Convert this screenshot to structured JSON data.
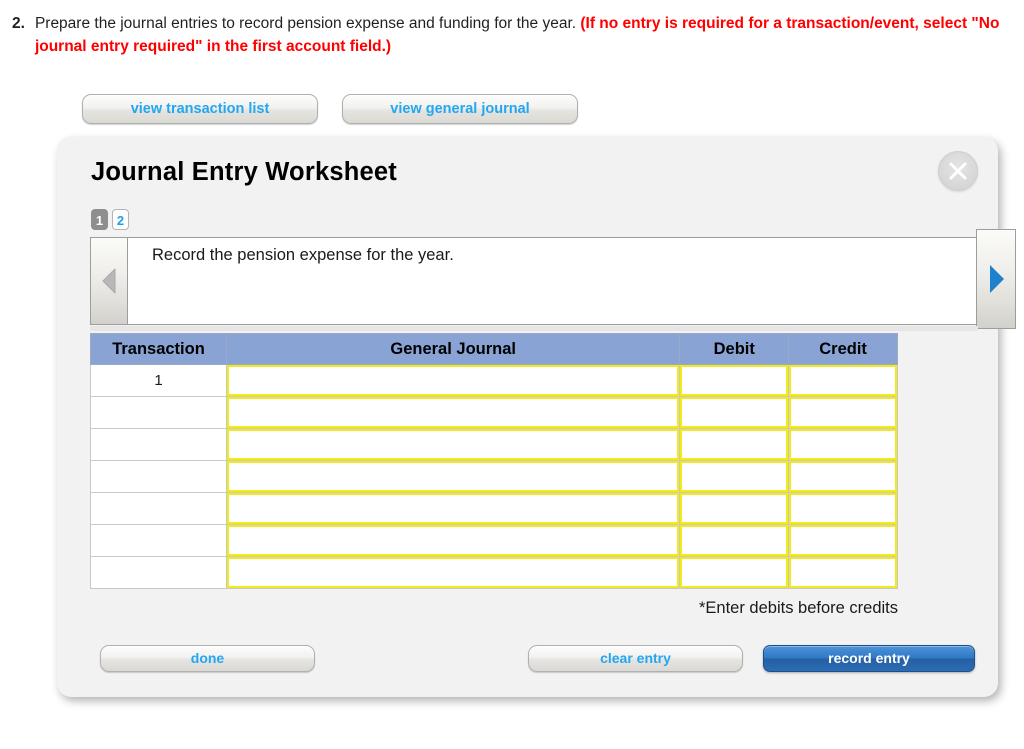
{
  "question": {
    "number": "2.",
    "text": "Prepare the journal entries to record pension expense and funding for the year. ",
    "note": "(If no entry is required for a transaction/event, select \"No journal entry required\" in the first account field.)"
  },
  "view_buttons": {
    "transaction_list": "view transaction list",
    "general_journal": "view general journal"
  },
  "panel": {
    "title": "Journal Entry Worksheet",
    "close_label": "X",
    "steps": [
      {
        "label": "1",
        "state": "active"
      },
      {
        "label": "2",
        "state": "inactive"
      }
    ],
    "prompt": "Record the pension expense for the year.",
    "prev_arrow": "prev-arrow",
    "next_arrow": "next-arrow"
  },
  "table": {
    "headers": [
      "Transaction",
      "General Journal",
      "Debit",
      "Credit"
    ],
    "rows": [
      {
        "transaction": "1",
        "general_journal": "",
        "debit": "",
        "credit": ""
      },
      {
        "transaction": "",
        "general_journal": "",
        "debit": "",
        "credit": ""
      },
      {
        "transaction": "",
        "general_journal": "",
        "debit": "",
        "credit": ""
      },
      {
        "transaction": "",
        "general_journal": "",
        "debit": "",
        "credit": ""
      },
      {
        "transaction": "",
        "general_journal": "",
        "debit": "",
        "credit": ""
      },
      {
        "transaction": "",
        "general_journal": "",
        "debit": "",
        "credit": ""
      },
      {
        "transaction": "",
        "general_journal": "",
        "debit": "",
        "credit": ""
      }
    ],
    "hint": "*Enter debits before credits"
  },
  "footer": {
    "done": "done",
    "clear_entry": "clear entry",
    "record_entry": "record entry"
  },
  "colors": {
    "header_blue": "#8aa3d5",
    "field_yellow": "#f2ea1c",
    "link_blue": "#22a7f0",
    "note_red": "#ff0000",
    "panel_bg": "#f2f2f2",
    "record_btn_blue": "#2f78c4"
  }
}
